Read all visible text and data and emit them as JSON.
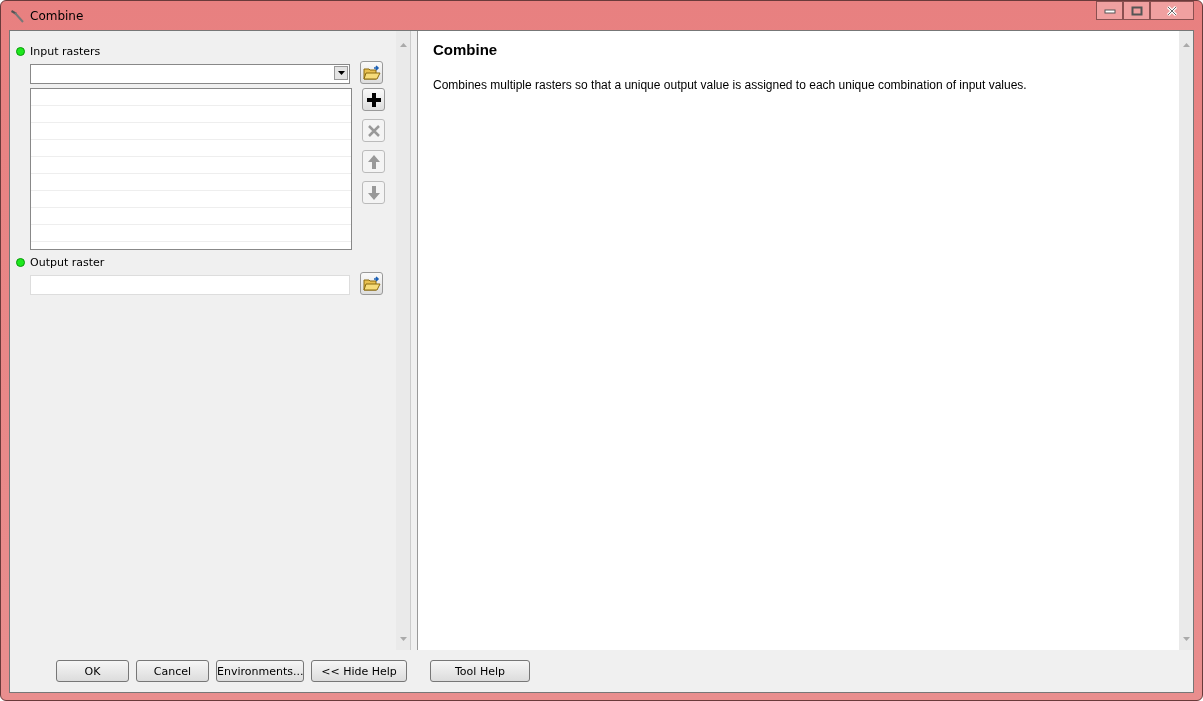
{
  "window": {
    "title": "Combine"
  },
  "parameters": [
    {
      "kind": "multi",
      "label": "Input rasters",
      "required": true
    },
    {
      "kind": "single",
      "label": "Output raster",
      "required": true
    }
  ],
  "help": {
    "title": "Combine",
    "text": "Combines multiple rasters so that a unique output value is assigned to each unique combination of input values."
  },
  "buttons": [
    {
      "label": "OK"
    },
    {
      "label": "Cancel"
    },
    {
      "label": "Environments..."
    },
    {
      "label": "<< Hide Help"
    },
    {
      "label": "Tool Help"
    }
  ]
}
